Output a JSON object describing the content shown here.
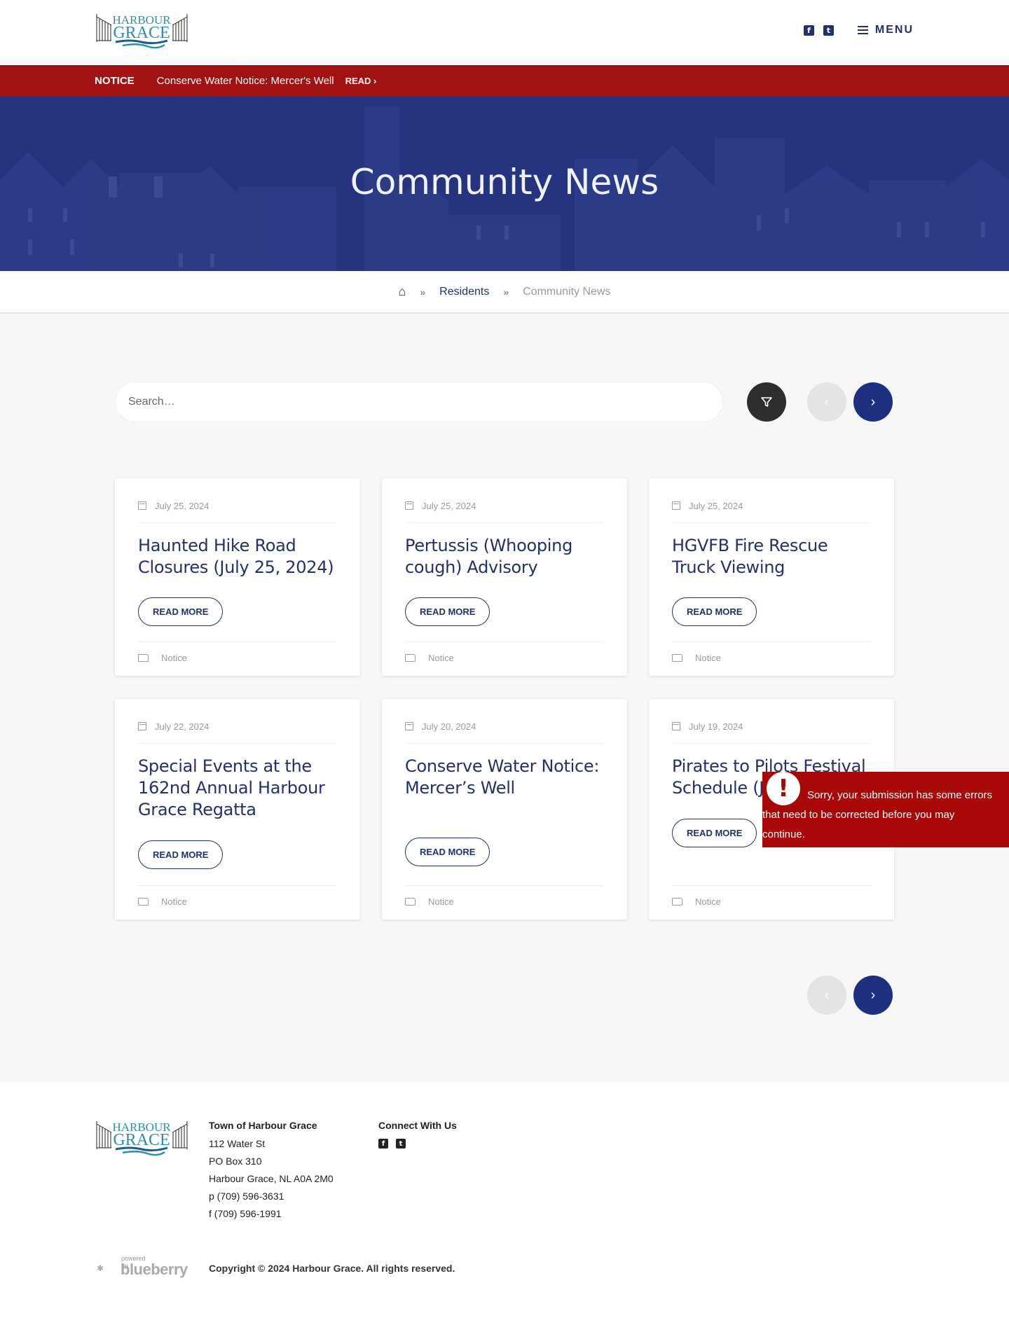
{
  "header": {
    "logo_line1": "HARBOUR",
    "logo_line2": "GRACE",
    "social": [
      {
        "name": "facebook",
        "glyph": "f"
      },
      {
        "name": "twitter",
        "glyph": "t"
      }
    ],
    "menu_label": "MENU"
  },
  "notice": {
    "label": "NOTICE",
    "text": "Conserve Water Notice: Mercer's Well",
    "read_label": "READ ›"
  },
  "hero": {
    "title": "Community News"
  },
  "breadcrumb": {
    "home_icon": "⌂",
    "separator": "»",
    "items": [
      "Residents",
      "Community News"
    ]
  },
  "search": {
    "placeholder": "Search…",
    "value": ""
  },
  "controls": {
    "filter_icon": "filter",
    "prev_glyph": "‹",
    "next_glyph": "›"
  },
  "cards": [
    {
      "date": "July 25, 2024",
      "title": "Haunted Hike Road Closures (July 25, 2024)",
      "button": "READ MORE",
      "category": "Notice"
    },
    {
      "date": "July 25, 2024",
      "title": "Pertussis (Whooping cough) Advisory",
      "button": "READ MORE",
      "category": "Notice"
    },
    {
      "date": "July 25, 2024",
      "title": "HGVFB Fire Rescue Truck Viewing",
      "button": "READ MORE",
      "category": "Notice"
    },
    {
      "date": "July 22, 2024",
      "title": "Special Events at the 162nd Annual Harbour Grace Regatta",
      "button": "READ MORE",
      "category": "Notice"
    },
    {
      "date": "July 20, 2024",
      "title": "Conserve Water Notice: Mercer’s Well",
      "button": "READ MORE",
      "category": "Notice"
    },
    {
      "date": "July 19, 2024",
      "title": "Pirates to Pilots Festival Schedule (July 2024)",
      "button": "READ MORE",
      "category": "Notice"
    }
  ],
  "error": {
    "icon": "!",
    "message": "Sorry, your submission has some errors that need to be corrected before you may continue."
  },
  "footer": {
    "org_heading": "Town of Harbour Grace",
    "address": [
      "112 Water St",
      "PO Box 310",
      "Harbour Grace, NL A0A 2M0",
      "p (709) 596-3631",
      "f (709) 596-1991"
    ],
    "connect_heading": "Connect With Us",
    "powered_by": "powered by",
    "brand": "blueberry",
    "copyright": "Copyright © 2024 Harbour Grace. All rights reserved."
  },
  "colors": {
    "brand_navy": "#23306b",
    "notice_red": "#a31212",
    "hero_blue": "#26347f",
    "next_button": "#1e2f80",
    "error_red": "#a80808"
  }
}
